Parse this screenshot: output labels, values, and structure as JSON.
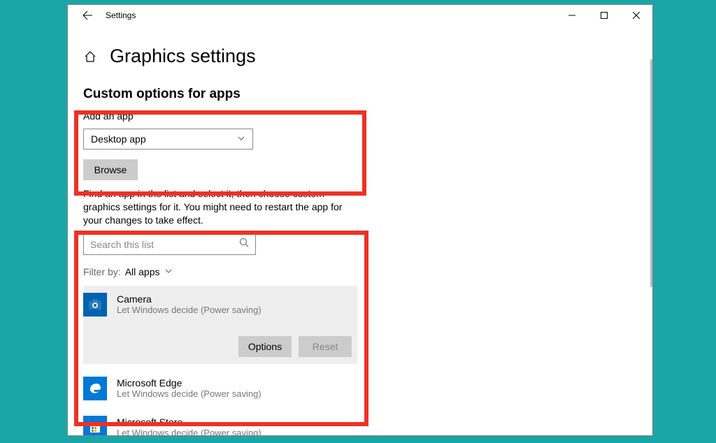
{
  "titlebar": {
    "app_title": "Settings"
  },
  "page": {
    "title": "Graphics settings",
    "subhead": "Custom options for apps",
    "add_app_label": "Add an app",
    "app_type_selected": "Desktop app",
    "browse_label": "Browse",
    "hint": "Find an app in the list and select it, then choose custom graphics settings for it. You might need to restart the app for your changes to take effect.",
    "search_placeholder": "Search this list",
    "filter_prefix": "Filter by:",
    "filter_value": "All apps"
  },
  "apps": [
    {
      "name": "Camera",
      "sub": "Let Windows decide (Power saving)",
      "color": "#0063b1"
    },
    {
      "name": "Microsoft Edge",
      "sub": "Let Windows decide (Power saving)",
      "color": "#0078d7"
    },
    {
      "name": "Microsoft Store",
      "sub": "Let Windows decide (Power saving)",
      "color": "#0078d7"
    }
  ],
  "actions": {
    "options": "Options",
    "reset": "Reset"
  }
}
